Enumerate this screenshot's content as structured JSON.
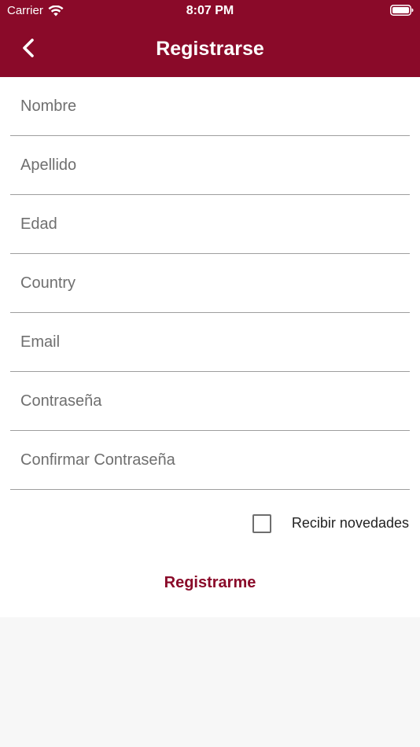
{
  "status_bar": {
    "carrier": "Carrier",
    "time": "8:07 PM",
    "wifi_icon": "wifi-icon",
    "battery_icon": "battery-icon"
  },
  "nav": {
    "back_icon": "chevron-left-icon",
    "title": "Registrarse"
  },
  "form": {
    "fields": [
      {
        "placeholder": "Nombre",
        "value": ""
      },
      {
        "placeholder": "Apellido",
        "value": ""
      },
      {
        "placeholder": "Edad",
        "value": ""
      },
      {
        "placeholder": "Country",
        "value": ""
      },
      {
        "placeholder": "Email",
        "value": ""
      },
      {
        "placeholder": "Contraseña",
        "value": ""
      },
      {
        "placeholder": "Confirmar Contraseña",
        "value": ""
      }
    ],
    "newsletter": {
      "label": "Recibir novedades",
      "checked": false
    },
    "submit_label": "Registrarme"
  },
  "colors": {
    "brand": "#8a0a29",
    "background": "#f7f7f7",
    "card": "#ffffff",
    "divider": "#9e9e9e",
    "placeholder": "#6f6f6f"
  }
}
